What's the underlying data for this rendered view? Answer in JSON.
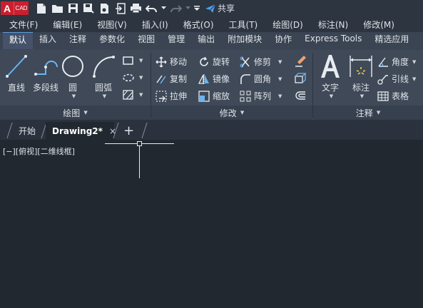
{
  "app": {
    "logo_letter": "A",
    "logo_text": "CAD"
  },
  "quick_access": {
    "share_label": "共享"
  },
  "menubar": [
    "文件(F)",
    "编辑(E)",
    "视图(V)",
    "插入(I)",
    "格式(O)",
    "工具(T)",
    "绘图(D)",
    "标注(N)",
    "修改(M)"
  ],
  "ribbon_tabs": [
    "默认",
    "插入",
    "注释",
    "参数化",
    "视图",
    "管理",
    "输出",
    "附加模块",
    "协作",
    "Express Tools",
    "精选应用"
  ],
  "ribbon": {
    "draw": {
      "panel": "绘图",
      "line": "直线",
      "polyline": "多段线",
      "circle": "圆",
      "arc": "圆弧"
    },
    "modify": {
      "panel": "修改",
      "move": "移动",
      "rotate": "旋转",
      "trim": "修剪",
      "copy": "复制",
      "mirror": "镜像",
      "fillet": "圆角",
      "stretch": "拉伸",
      "scale": "缩放",
      "array": "阵列"
    },
    "annotation": {
      "panel": "注释",
      "text": "文字",
      "dimension": "标注",
      "angle": "角度",
      "leader": "引线",
      "table": "表格"
    }
  },
  "file_tabs": {
    "start": "开始",
    "drawing": "Drawing2*",
    "close": "×",
    "add": "+"
  },
  "viewport": {
    "label": "[−][俯视][二维线框]"
  },
  "colors": {
    "accent": "#5aa0e0",
    "logo": "#c8202f",
    "background": "#212830"
  }
}
